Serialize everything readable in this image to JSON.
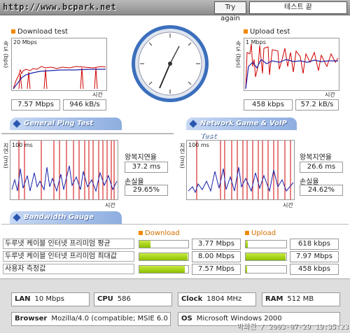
{
  "header": {
    "url": "http://www.bcpark.net",
    "try_again": "Try again",
    "test_status": "테스트 끝"
  },
  "download": {
    "title": "Download test",
    "scale": "20 Mbps",
    "yunit": "속도 (bps)",
    "xunit": "시간",
    "speed_bps": "7.57 Mbps",
    "speed_bytes": "946 kB/s"
  },
  "upload": {
    "title": "Upload test",
    "scale": "1 Mbps",
    "yunit": "속도 (bps)",
    "xunit": "시간",
    "speed_bps": "458 kbps",
    "speed_bytes": "57.2 kB/s"
  },
  "ping": {
    "tab": "General Ping Test",
    "scale": "100 ms",
    "yunit": "지연 (ms)",
    "xunit": "시간",
    "rtt_label": "왕복지연율",
    "rtt": "37.2 ms",
    "loss_label": "손실율",
    "loss": "29.65%"
  },
  "game": {
    "tab": "Network Game & VoIP Test",
    "scale": "100 ms",
    "yunit": "지연 (ms)",
    "xunit": "시간",
    "rtt_label": "왕복지연율",
    "rtt": "26.6 ms",
    "loss_label": "손실율",
    "loss": "24.62%"
  },
  "gauge": {
    "tab": "Bandwidth Gauge",
    "download_title": "Download",
    "upload_title": "Upload",
    "rows": [
      {
        "label": "두루넷 케이블 인터넷 프리미엄 평균",
        "download": "3.77 Mbps",
        "download_pct": 0.23,
        "upload": "618 kbps",
        "upload_pct": 0.05
      },
      {
        "label": "두루넷 케이블 인터넷 프리미엄 최대값",
        "download": "8.00 Mbps",
        "download_pct": 0.98,
        "upload": "7.97 Mbps",
        "upload_pct": 0.98
      },
      {
        "label": "사용자 측정값",
        "download": "7.57 Mbps",
        "download_pct": 0.93,
        "upload": "458 kbps",
        "upload_pct": 0.04
      }
    ]
  },
  "system": {
    "lan_label": "LAN",
    "lan": "10 Mbps",
    "cpu_label": "CPU",
    "cpu": "586",
    "clock_label": "Clock",
    "clock": "1804 MHz",
    "ram_label": "RAM",
    "ram": "512 MB",
    "browser_label": "Browser",
    "browser": "Mozilla/4.0 (compatible; MSIE 6.0",
    "os_label": "OS",
    "os": "Microsoft Windows 2000"
  },
  "stamp": "박희진 / 2003-07-29 19:35:23",
  "colors": {
    "accent": "#f08800",
    "tab": "#2a57b0",
    "bar": "#9ccc10",
    "series_red": "#d00000",
    "series_blue": "#1a22a8"
  }
}
